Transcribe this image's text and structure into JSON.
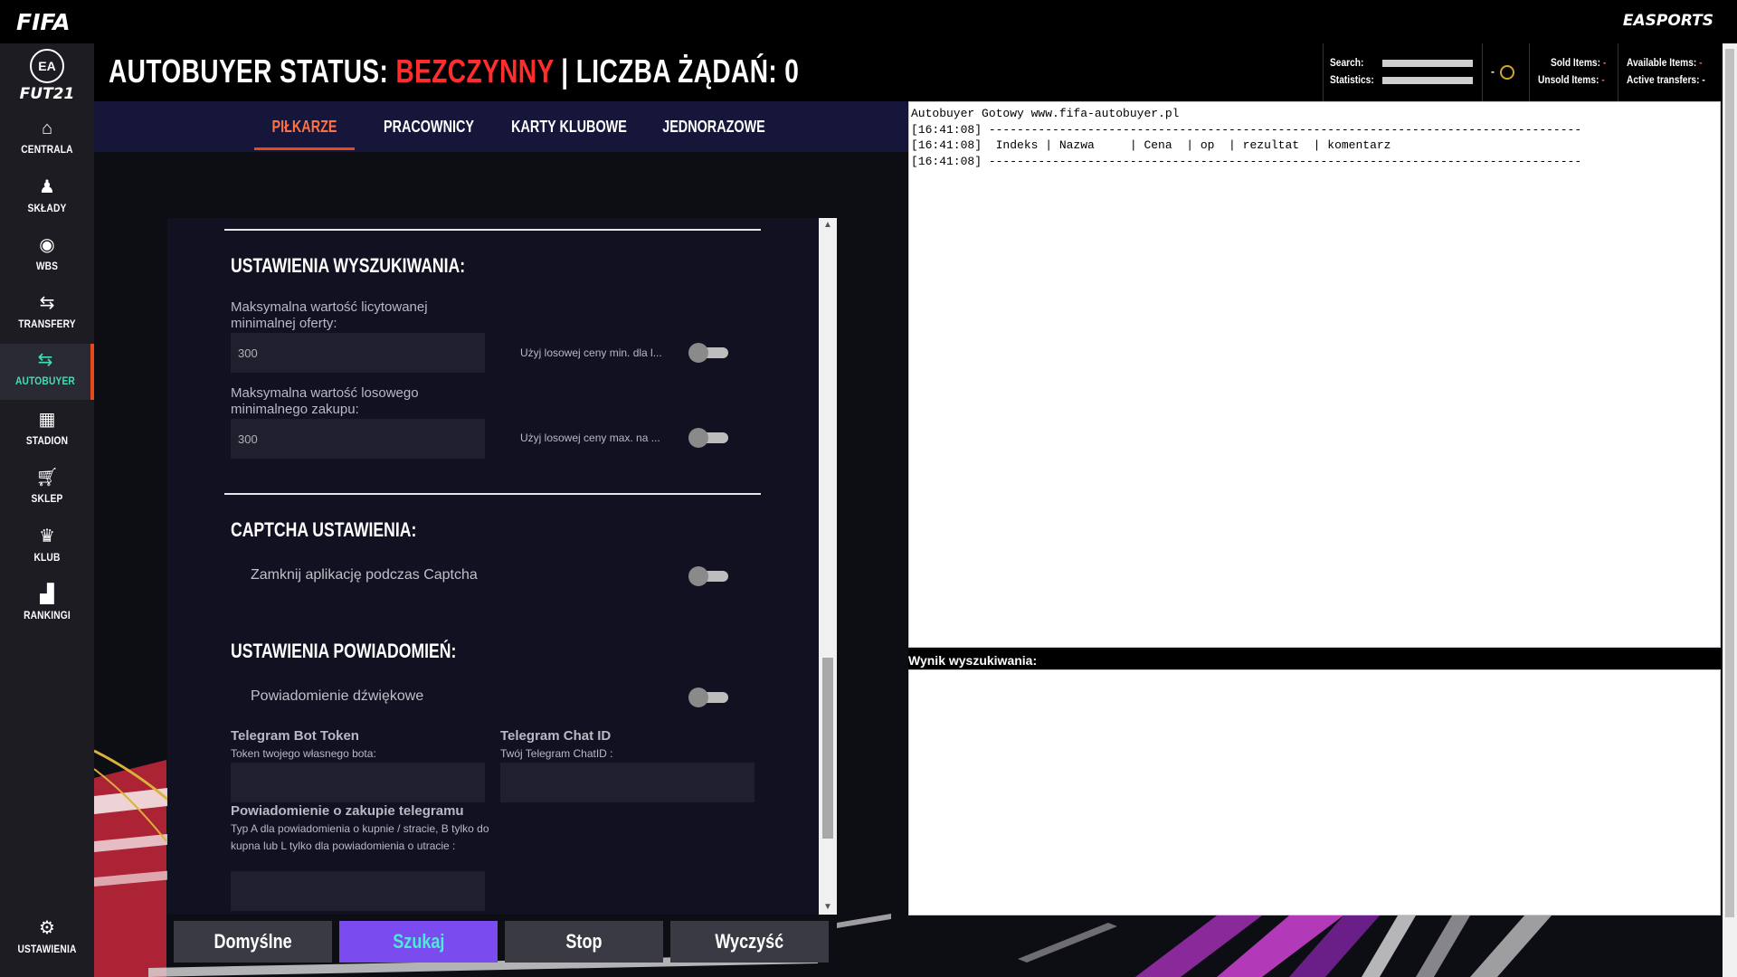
{
  "topbar": {
    "brand": "FIFA",
    "publisher": "EASPORTS"
  },
  "sidebar": {
    "logo": {
      "badge": "EA",
      "title": "FUT21"
    },
    "items": [
      {
        "label": "CENTRALA",
        "icon": "home-icon"
      },
      {
        "label": "SKŁADY",
        "icon": "squad-icon"
      },
      {
        "label": "WBS",
        "icon": "ball-icon"
      },
      {
        "label": "TRANSFERY",
        "icon": "transfer-arrows-icon"
      },
      {
        "label": "AUTOBUYER",
        "icon": "autobuyer-arrows-icon",
        "active": true
      },
      {
        "label": "STADION",
        "icon": "stadium-icon"
      },
      {
        "label": "SKLEP",
        "icon": "cart-icon"
      },
      {
        "label": "KLUB",
        "icon": "club-icon"
      },
      {
        "label": "RANKINGI",
        "icon": "leaderboard-icon"
      }
    ],
    "settings": {
      "label": "USTAWIENIA",
      "icon": "gear-icon"
    }
  },
  "header": {
    "status_prefix": "AUTOBUYER STATUS: ",
    "status_value": "BEZCZYNNY",
    "requests_text": " | LICZBA ŻĄDAŃ: 0"
  },
  "stats": {
    "search_label": "Search:",
    "statistics_label": "Statistics:",
    "coins_value": "-",
    "sold_label": "Sold Items:",
    "sold_value": "-",
    "unsold_label": "Unsold Items:",
    "unsold_value": "-",
    "available_label": "Available Items:",
    "available_value": "-",
    "active_label": "Active transfers:",
    "active_value": "-"
  },
  "tabs": [
    {
      "label": "PIŁKARZE",
      "active": true
    },
    {
      "label": "PRACOWNICY"
    },
    {
      "label": "KARTY KLUBOWE"
    },
    {
      "label": "JEDNORAZOWE"
    }
  ],
  "search_settings": {
    "title": "USTAWIENIA WYSZUKIWANIA:",
    "min_bid_label": "Maksymalna wartość licytowanej minimalnej oferty:",
    "min_bid_value": "300",
    "random_min_label": "Użyj losowej ceny min. dla l...",
    "min_buy_label": "Maksymalna wartość losowego minimalnego zakupu:",
    "min_buy_value": "300",
    "random_max_label": "Użyj losowej ceny max. na ..."
  },
  "captcha": {
    "title": "CAPTCHA USTAWIENIA:",
    "close_label": "Zamknij aplikację podczas Captcha"
  },
  "notifications": {
    "title": "USTAWIENIA POWIADOMIEŃ:",
    "sound_label": "Powiadomienie dźwiękowe",
    "bot_token_label": "Telegram Bot Token",
    "bot_token_sub": "Token twojego własnego bota:",
    "bot_token_value": "",
    "chat_id_label": "Telegram Chat ID",
    "chat_id_sub": "Twój Telegram ChatID :",
    "chat_id_value": "",
    "purchase_label": "Powiadomienie o zakupie telegramu",
    "purchase_sub": "Typ A dla powiadomienia o kupnie / stracie, B tylko do kupna lub L tylko dla powiadomienia o utracie :",
    "purchase_value": ""
  },
  "buttons": {
    "default": "Domyślne",
    "search": "Szukaj",
    "stop": "Stop",
    "clear": "Wyczyść"
  },
  "log": {
    "lines": [
      "Autobuyer Gotowy www.fifa-autobuyer.pl",
      "[16:41:08] ------------------------------------------------------------------------------------",
      "[16:41:08]  Indeks | Nazwa     | Cena  | op  | rezultat  | komentarz",
      "[16:41:08] ------------------------------------------------------------------------------------"
    ]
  },
  "results": {
    "title": "Wynik wyszukiwania:"
  },
  "colors": {
    "accent": "#e64a19",
    "status_red": "#ff2d2d",
    "primary_button": "#7a4cf0",
    "active_nav": "#3fe0b0"
  }
}
